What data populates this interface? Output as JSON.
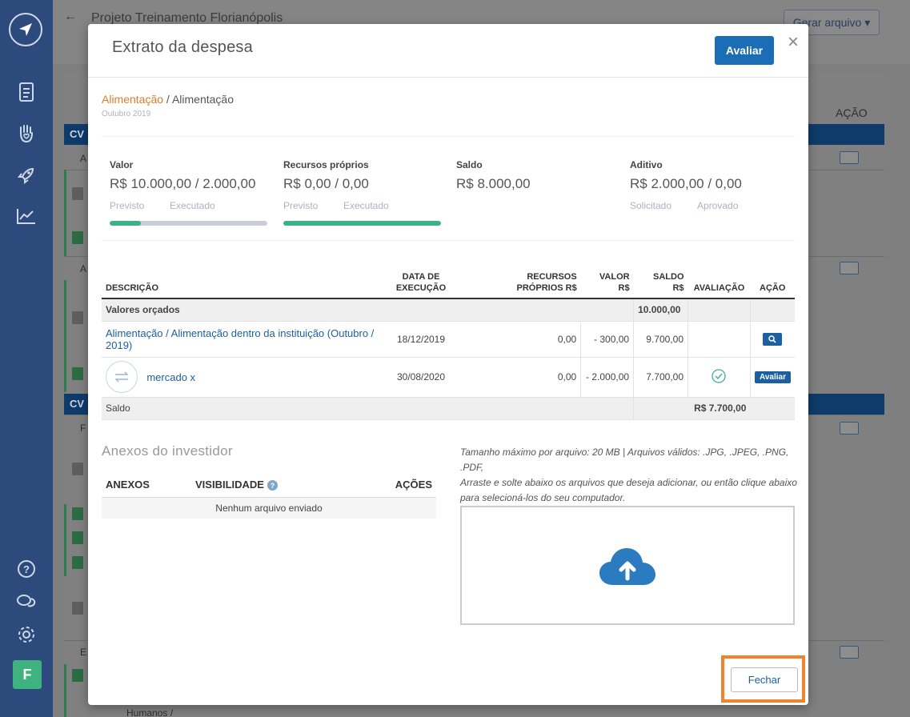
{
  "background": {
    "title": "Projeto Treinamento Florianópolis",
    "gerar_button": "Gerar arquivo ▾",
    "acao_header": "AÇÃO",
    "cv_label": "CV",
    "row_labels": [
      "A",
      "A",
      "F",
      "E"
    ],
    "bottom_label": "Humanos /"
  },
  "modal": {
    "title": "Extrato da despesa",
    "avaliar_button": "Avaliar",
    "close": "×",
    "breadcrumb": {
      "category": "Alimentação",
      "separator": " / ",
      "item": "Alimentação",
      "period": "Outubro 2019"
    },
    "summary": {
      "valor": {
        "label": "Valor",
        "value": "R$ 10.000,00 / 2.000,00",
        "sub1": "Previsto",
        "sub2": "Executado",
        "progress": 0.2
      },
      "recursos": {
        "label": "Recursos próprios",
        "value": "R$ 0,00 / 0,00",
        "sub1": "Previsto",
        "sub2": "Executado",
        "progress": 1.0
      },
      "saldo": {
        "label": "Saldo",
        "value": "R$ 8.000,00"
      },
      "aditivo": {
        "label": "Aditivo",
        "value": "R$ 2.000,00 / 0,00",
        "sub1": "Solicitado",
        "sub2": "Aprovado"
      }
    },
    "table": {
      "headers": {
        "descricao": "DESCRIÇÃO",
        "data1": "DATA DE",
        "data2": "EXECUÇÃO",
        "recursos1": "RECURSOS",
        "recursos2": "PRÓPRIOS R$",
        "valor1": "VALOR",
        "valor2": "R$",
        "saldo1": "SALDO",
        "saldo2": "R$",
        "avaliacao": "AVALIAÇÃO",
        "acao": "AÇÃO"
      },
      "orcados_label": "Valores orçados",
      "orcados_saldo": "10.000,00",
      "rows": [
        {
          "descricao": "Alimentação / Alimentação dentro da instituição (Outubro / 2019)",
          "data": "18/12/2019",
          "recursos": "0,00",
          "valor": "- 300,00",
          "saldo": "9.700,00"
        },
        {
          "descricao": "mercado x",
          "data": "30/08/2020",
          "recursos": "0,00",
          "valor": "- 2.000,00",
          "saldo": "7.700,00",
          "acao": "Avaliar"
        }
      ],
      "footer_label": "Saldo",
      "footer_value": "R$ 7.700,00"
    },
    "anexos": {
      "title": "Anexos do investidor",
      "col_anexos": "ANEXOS",
      "col_visibilidade": "VISIBILIDADE",
      "help": "?",
      "col_acoes": "AÇÕES",
      "empty": "Nenhum arquivo enviado"
    },
    "upload": {
      "info1": "Tamanho máximo por arquivo: 20 MB | Arquivos válidos: .JPG, .JPEG, .PNG, .PDF,",
      "info2": "Arraste e solte abaixo os arquivos que deseja adicionar, ou então clique abaixo para selecioná-los do seu computador."
    },
    "fechar_button": "Fechar"
  },
  "sidebar": {
    "avatar_letter": "F"
  },
  "colors": {
    "primary": "#1b6db5",
    "accent": "#e07b2c",
    "success": "#3bb287",
    "sidebar": "#2c4a7b",
    "highlight": "#f0832b"
  }
}
